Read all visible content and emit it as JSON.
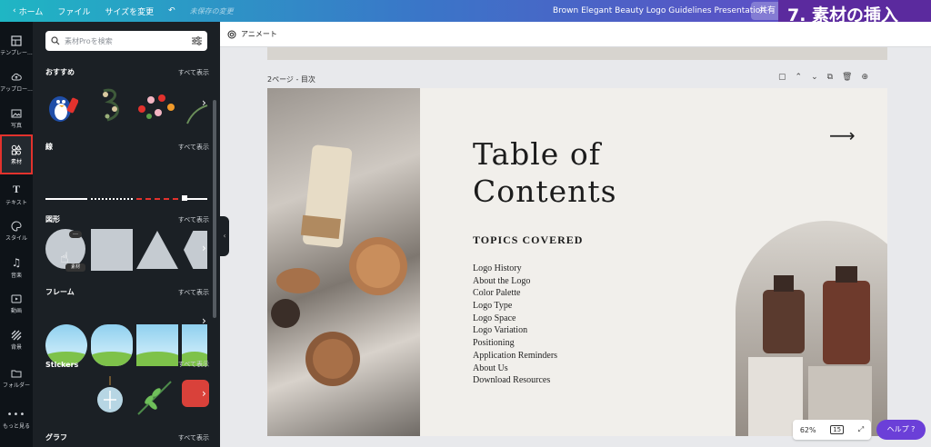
{
  "topbar": {
    "home_label": "ホーム",
    "file_label": "ファイル",
    "resize_label": "サイズを変更",
    "unsaved_label": "未保存の変更",
    "doc_title": "Brown Elegant Beauty Logo Guidelines Presentation",
    "share_label": "共有"
  },
  "overlay_caption": "7. 素材の挿入",
  "rail": {
    "items": [
      {
        "label": "テンプレー...",
        "icon": "template-icon"
      },
      {
        "label": "アップロー...",
        "icon": "upload-icon"
      },
      {
        "label": "写真",
        "icon": "photo-icon"
      },
      {
        "label": "素材",
        "icon": "elements-icon",
        "active": true
      },
      {
        "label": "テキスト",
        "icon": "text-icon"
      },
      {
        "label": "スタイル",
        "icon": "style-icon"
      },
      {
        "label": "音楽",
        "icon": "music-icon"
      },
      {
        "label": "動画",
        "icon": "video-icon"
      },
      {
        "label": "背景",
        "icon": "background-icon"
      },
      {
        "label": "フォルダー",
        "icon": "folder-icon"
      },
      {
        "label": "もっと見る",
        "icon": "more-icon"
      }
    ]
  },
  "panel": {
    "search_placeholder": "素材Proを検索",
    "see_all": "すべて表示",
    "sections": {
      "recommended": "おすすめ",
      "lines": "線",
      "shapes": "図形",
      "frames": "フレーム",
      "stickers": "Stickers",
      "graphs": "グラフ"
    },
    "shape_tooltip": "素材"
  },
  "editor": {
    "animate_label": "アニメート",
    "page_label": "2ページ - 目次",
    "zoom": "62%",
    "page_count": "15",
    "help_label": "ヘルプ ?"
  },
  "slide": {
    "title_line1": "Table of",
    "title_line2": "Contents",
    "topics_heading": "TOPICS COVERED",
    "topics": [
      "Logo History",
      "About the Logo",
      "Color Palette",
      "Logo Type",
      "Logo Space",
      "Logo Variation",
      "Positioning",
      "Application Reminders",
      "About Us",
      "Download Resources"
    ]
  },
  "colors": {
    "topbar_start": "#1fb6c4",
    "topbar_end": "#6b3fc4",
    "panel_bg": "#1b2025",
    "active_outline": "#e2322d",
    "help_button": "#6b3fd8",
    "caption_bg": "#5b2a9e"
  }
}
